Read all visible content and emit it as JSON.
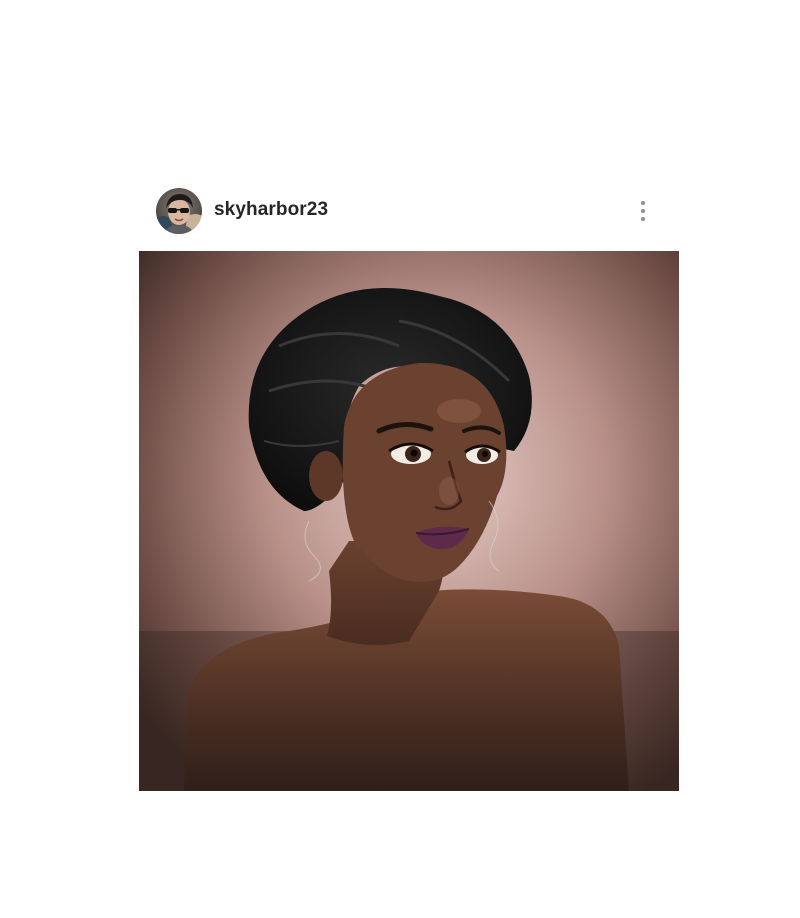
{
  "post": {
    "username": "skyharbor23",
    "avatar_icon": "profile-avatar",
    "more_icon": "more-options-icon",
    "image_description_icon": "portrait-artwork"
  },
  "colors": {
    "username_text": "#262626",
    "more_dots": "#8e8e8e",
    "background": "#ffffff"
  }
}
